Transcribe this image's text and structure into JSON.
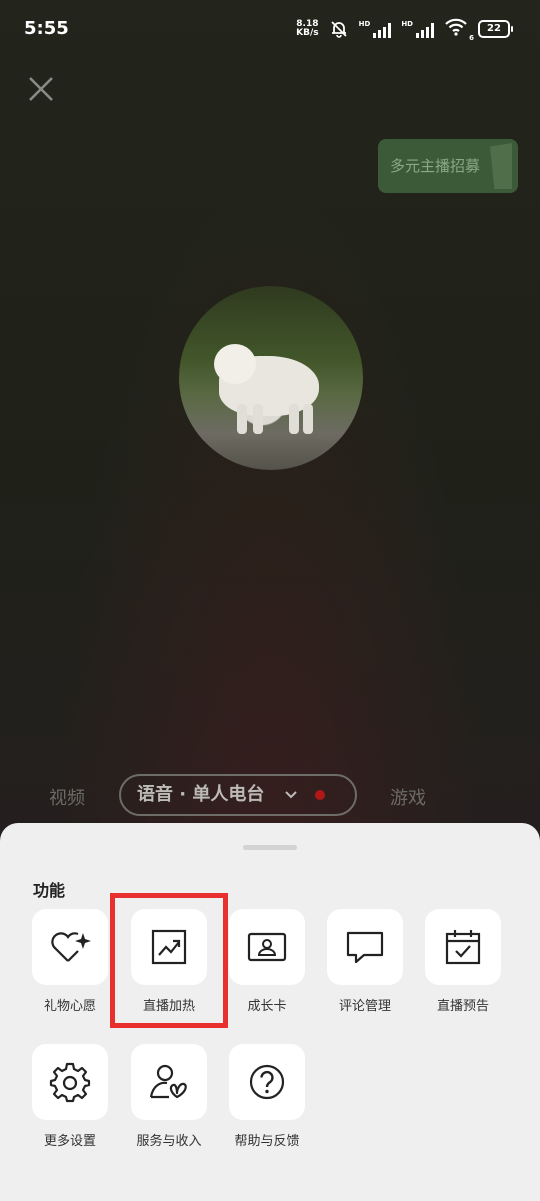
{
  "status_bar": {
    "time": "5:55",
    "net_speed_value": "8.18",
    "net_speed_unit": "KB/s",
    "hd1": "HD",
    "hd2": "HD",
    "wifi_sub": "6",
    "battery": "22",
    "icons": [
      "bell-off-icon",
      "signal-icon",
      "signal-icon",
      "wifi-icon",
      "battery-icon"
    ]
  },
  "top": {
    "close_icon": "close-icon",
    "recruit_label": "多元主播招募"
  },
  "mode_tabs": {
    "left": "视频",
    "selected": "语音 · 单人电台",
    "selected_icon": "chevron-down-icon",
    "right": "游戏",
    "live_dot_color": "#b01818"
  },
  "sheet": {
    "section_title": "功能",
    "items": [
      {
        "label": "礼物心愿",
        "icon": "heart-sparkle-icon"
      },
      {
        "label": "直播加热",
        "icon": "trend-up-icon",
        "highlighted": true
      },
      {
        "label": "成长卡",
        "icon": "profile-card-icon"
      },
      {
        "label": "评论管理",
        "icon": "comment-icon"
      },
      {
        "label": "直播预告",
        "icon": "calendar-check-icon"
      },
      {
        "label": "更多设置",
        "icon": "gear-icon"
      },
      {
        "label": "服务与收入",
        "icon": "person-butterfly-icon"
      },
      {
        "label": "帮助与反馈",
        "icon": "help-icon"
      }
    ]
  },
  "colors": {
    "highlight": "#e8302f",
    "sheet_bg": "#efefef",
    "recruit_bg": "#3c5a38"
  }
}
